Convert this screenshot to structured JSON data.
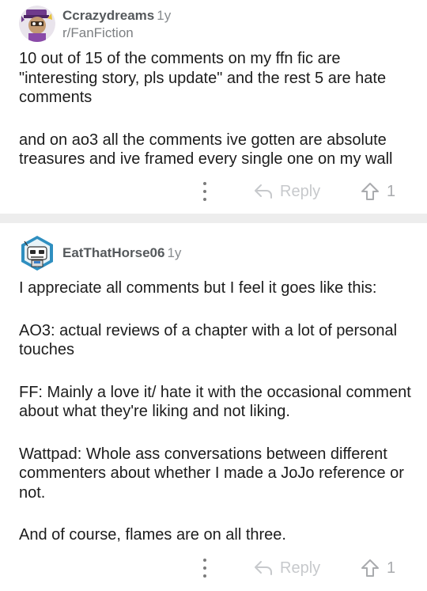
{
  "comments": [
    {
      "username": "Ccrazydreams",
      "age": "1y",
      "subreddit": "r/FanFiction",
      "paragraphs": [
        "10 out of 15 of the comments on my ffn fic are \"interesting story, pls update\" and the rest 5 are hate comments",
        "and on ao3 all the comments ive gotten are absolute treasures and ive framed every single one on my wall"
      ],
      "reply_label": "Reply",
      "votes": "1"
    },
    {
      "username": "EatThatHorse06",
      "age": "1y",
      "paragraphs": [
        "I appreciate all comments but I feel it goes like this:",
        "AO3: actual reviews of a chapter with a lot of personal touches",
        "FF: Mainly a love it/ hate it with the occasional comment about what they're liking and not liking.",
        "Wattpad: Whole ass conversations between different commenters about whether I made a JoJo reference or not.",
        "And of course, flames are on all three."
      ],
      "reply_label": "Reply",
      "votes": "1"
    }
  ]
}
